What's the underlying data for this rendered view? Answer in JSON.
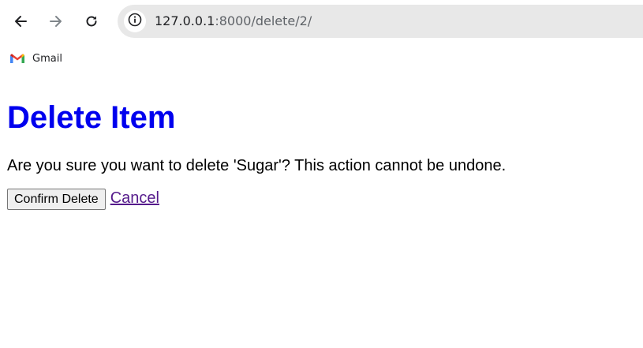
{
  "browser": {
    "url_host": "127.0.0.1",
    "url_path": ":8000/delete/2/",
    "bookmarks": [
      {
        "label": "Gmail",
        "icon": "gmail-icon"
      }
    ]
  },
  "page": {
    "title": "Delete Item",
    "message": "Are you sure you want to delete 'Sugar'? This action cannot be undone.",
    "confirm_label": "Confirm Delete",
    "cancel_label": "Cancel"
  },
  "colors": {
    "title": "#0000ee",
    "visited_link": "#551a8b",
    "omnibox_bg": "#e8e8e8"
  }
}
